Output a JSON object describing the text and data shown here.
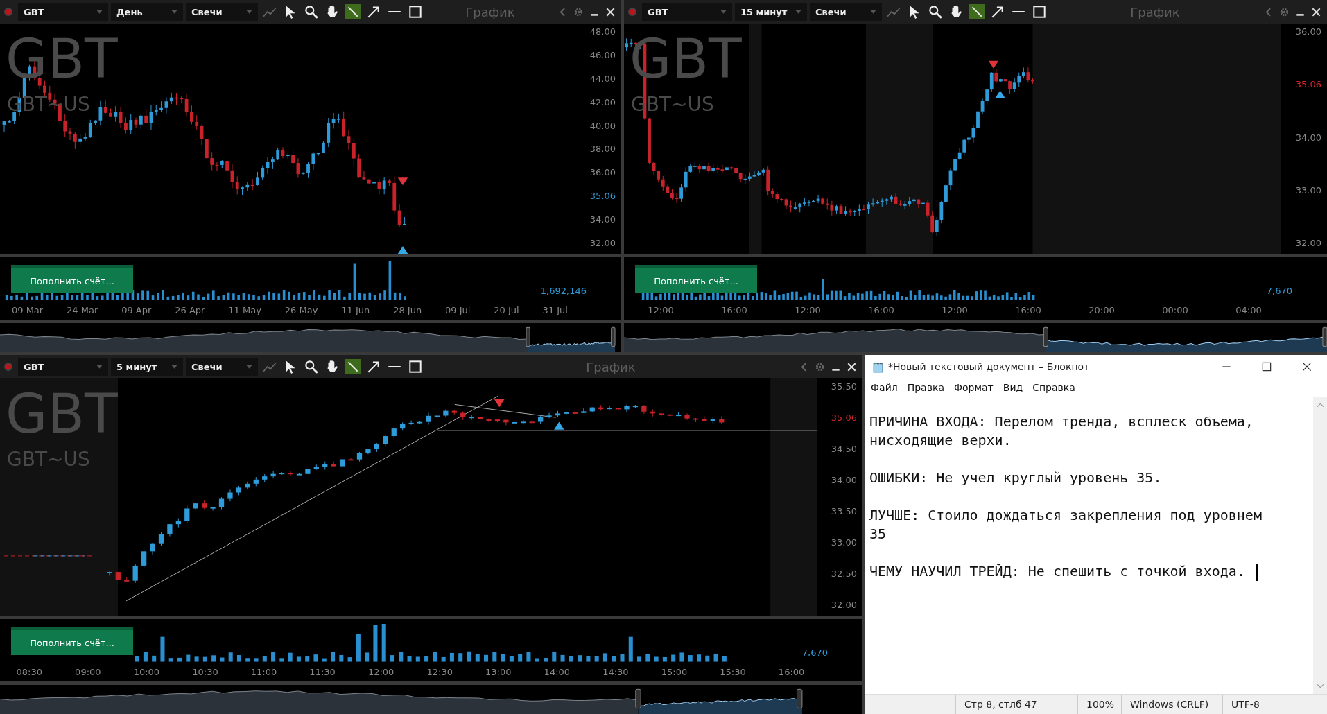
{
  "charts": [
    {
      "symbol": "GBT",
      "interval": "День",
      "style": "Свечи",
      "panel_title": "График",
      "watermark_symbol": "GBT",
      "watermark_name": "GBT~US",
      "price_ticks": [
        "48.00",
        "46.00",
        "44.00",
        "42.00",
        "40.00",
        "38.00",
        "36.00",
        "34.00",
        "32.00"
      ],
      "last_price": {
        "text": "35.06",
        "color": "#2f9bd8"
      },
      "deposit_button": "Пополнить счёт...",
      "volume_reading": "1,692,146",
      "time_labels": [
        "09 Mar",
        "24 Mar",
        "09 Apr",
        "26 Apr",
        "11 May",
        "26 May",
        "11 Jun",
        "28 Jun",
        "09 Jul",
        "20 Jul",
        "31 Jul"
      ]
    },
    {
      "symbol": "GBT",
      "interval": "15 минут",
      "style": "Свечи",
      "panel_title": "График",
      "watermark_symbol": "GBT",
      "watermark_name": "GBT~US",
      "price_ticks": [
        "36.00",
        "34.00",
        "33.00",
        "32.00"
      ],
      "last_price": {
        "text": "35.06",
        "color": "#d0262c"
      },
      "deposit_button": "Пополнить счёт...",
      "volume_reading": "7,670",
      "time_labels": [
        "12:00",
        "16:00",
        "12:00",
        "16:00",
        "12:00",
        "16:00",
        "20:00",
        "00:00",
        "04:00"
      ]
    },
    {
      "symbol": "GBT",
      "interval": "5 минут",
      "style": "Свечи",
      "panel_title": "График",
      "watermark_symbol": "GBT",
      "watermark_name": "GBT~US",
      "price_ticks": [
        "35.50",
        "34.50",
        "34.00",
        "33.50",
        "33.00",
        "32.50",
        "32.00"
      ],
      "last_price": {
        "text": "35.06",
        "color": "#d0262c"
      },
      "deposit_button": "Пополнить счёт...",
      "volume_reading": "7,670",
      "time_labels": [
        "08:30",
        "09:00",
        "10:00",
        "10:30",
        "11:00",
        "11:30",
        "12:00",
        "12:30",
        "13:00",
        "14:00",
        "14:30",
        "15:00",
        "15:30",
        "16:00"
      ]
    }
  ],
  "notepad": {
    "title": "*Новый текстовый документ – Блокнот",
    "menu": [
      "Файл",
      "Правка",
      "Формат",
      "Вид",
      "Справка"
    ],
    "paragraphs": [
      "ПРИЧИНА ВХОДА: Перелом тренда, всплеск объема, нисходящие верхи.",
      "ОШИБКИ: Не учел круглый уровень 35.",
      "ЛУЧШЕ: Стоило дождаться закрепления под уровнем 35",
      "ЧЕМУ НАУЧИЛ ТРЕЙД: Не спешить с точкой входа."
    ],
    "status": [
      "Стр 8, стлб 47",
      "100%",
      "Windows (CRLF)",
      "UTF-8"
    ]
  }
}
